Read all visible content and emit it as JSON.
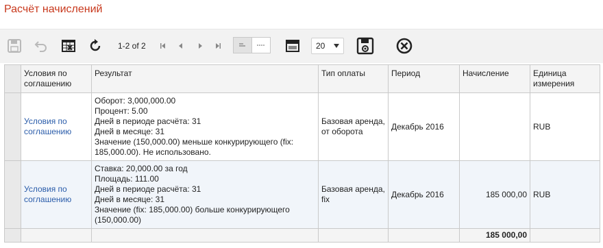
{
  "page": {
    "title": "Расчёт начислений"
  },
  "toolbar": {
    "pager_text": "1-2 of 2",
    "page_size": "20",
    "icons": [
      "save-icon",
      "undo-icon",
      "export-excel-icon",
      "refresh-icon",
      "first-page-icon",
      "prev-page-icon",
      "next-page-icon",
      "last-page-icon",
      "align-left-icon",
      "align-justify-icon",
      "window-icon",
      "save-settings-icon",
      "close-icon"
    ]
  },
  "table": {
    "headers": {
      "conditions": "Условия по соглашению",
      "result": "Результат",
      "payment_type": "Тип оплаты",
      "period": "Период",
      "accrual": "Начисление",
      "unit": "Единица измерения"
    },
    "rows": [
      {
        "conditions": "Условия по соглашению",
        "result_lines": [
          "Оборот: 3,000,000.00",
          "Процент: 5.00",
          "Дней в периоде расчёта: 31",
          "Дней в месяце: 31",
          "Значение (150,000.00) меньше конкурирующего (fix: 185,000.00). Не использовано."
        ],
        "payment_type": "Базовая аренда, от оборота",
        "period": "Декабрь 2016",
        "accrual": "",
        "unit": "RUB"
      },
      {
        "conditions": "Условия по соглашению",
        "result_lines": [
          "Ставка: 20,000.00 за год",
          "Площадь: 111.00",
          "Дней в периоде расчёта: 31",
          "Дней в месяце: 31",
          "Значение (fix: 185,000.00) больше конкурирующего (150,000.00)"
        ],
        "payment_type": "Базовая аренда, fix",
        "period": "Декабрь 2016",
        "accrual": "185 000,00",
        "unit": "RUB"
      }
    ],
    "total": {
      "accrual": "185 000,00"
    }
  }
}
